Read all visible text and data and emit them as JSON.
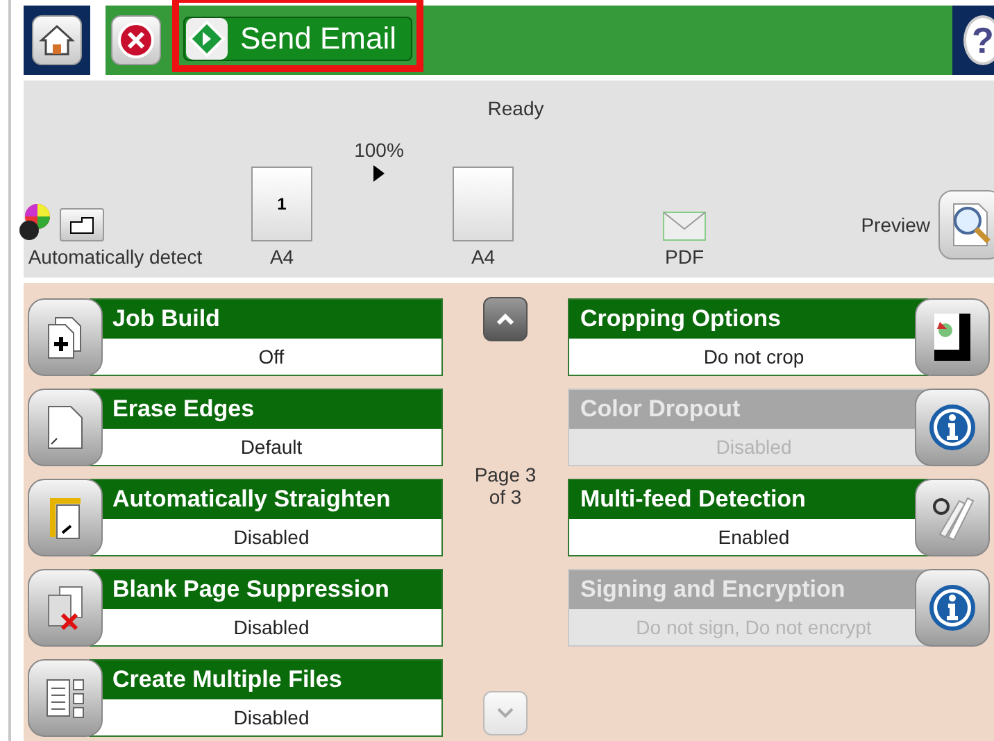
{
  "top_bar": {
    "title": "Send Email",
    "highlighted": true,
    "help_label": "?"
  },
  "status": "Ready",
  "summary": {
    "color_mode": "Automatically detect",
    "original_page": "1",
    "original_size": "A4",
    "scale": "100%",
    "output_size": "A4",
    "file_type": "PDF",
    "preview": "Preview"
  },
  "options_left": [
    {
      "title": "Job Build",
      "value": "Off",
      "disabled": false
    },
    {
      "title": "Erase Edges",
      "value": "Default",
      "disabled": false
    },
    {
      "title": "Automatically Straighten",
      "value": "Disabled",
      "disabled": false
    },
    {
      "title": "Blank Page Suppression",
      "value": "Disabled",
      "disabled": false
    },
    {
      "title": "Create Multiple Files",
      "value": "Disabled",
      "disabled": false
    }
  ],
  "pager": {
    "label": "Page 3\nof 3",
    "up_disabled": false,
    "down_disabled": true
  },
  "options_right": [
    {
      "title": "Cropping Options",
      "value": "Do not crop",
      "disabled": false
    },
    {
      "title": "Color Dropout",
      "value": "Disabled",
      "disabled": true
    },
    {
      "title": "Multi-feed Detection",
      "value": "Enabled",
      "disabled": false
    },
    {
      "title": "Signing and Encryption",
      "value": "Do not sign, Do not encrypt",
      "disabled": true
    }
  ]
}
